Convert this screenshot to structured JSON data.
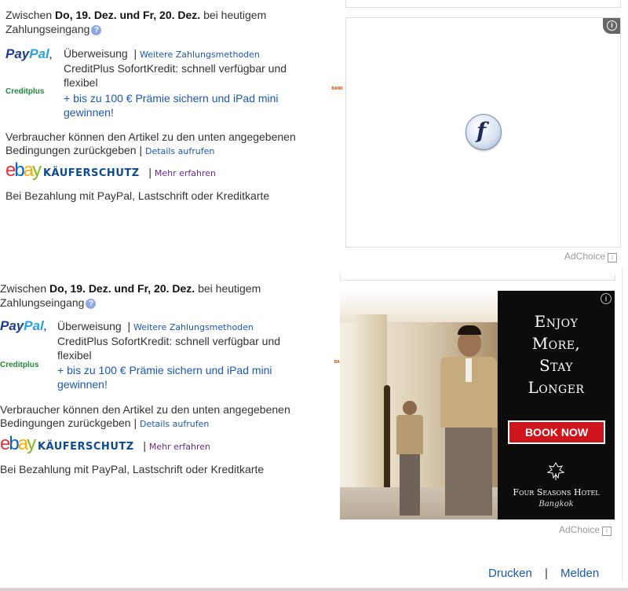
{
  "listing1": {
    "delivery_prefix": "Zwischen ",
    "delivery_dates": "Do, 19. Dez. und Fr, 20. Dez.",
    "delivery_suffix": " bei heutigem",
    "delivery_line2": "Zahlungseingang",
    "paypal_logo_a": "Pay",
    "paypal_logo_b": "Pal",
    "payment_transfer": "Überweisung",
    "more_payment_link": "Weitere Zahlungsmethoden",
    "creditplus_logo": "Creditplus",
    "creditplus_badge": "BANK",
    "creditplus_line1": "CreditPlus SofortKredit: schnell verfügbar und",
    "creditplus_line2": "flexibel",
    "promo_line1": "+ bis zu 100 € Prämie sichern und iPad mini",
    "promo_line2": "gewinnen!",
    "returns_line1": "Verbraucher können den Artikel zu den unten angegebenen",
    "returns_line2": "Bedingungen zurückgeben |",
    "details_link": "Details aufrufen",
    "ebay_logo": [
      "e",
      "b",
      "a",
      "y"
    ],
    "kauferschutz": "KÄUFERSCHUTZ",
    "learn_more_link": "Mehr erfahren",
    "protection_text": "Bei Bezahlung mit PayPal, Lastschrift oder Kreditkarte"
  },
  "listing2": {
    "delivery_prefix": "Zwischen ",
    "delivery_dates": "Do, 19. Dez. und Fr, 20. Dez.",
    "delivery_suffix": " bei heutigem",
    "delivery_line2": "Zahlungseingang",
    "paypal_logo_a": "Pay",
    "paypal_logo_b": "Pal",
    "payment_transfer": "Überweisung",
    "more_payment_link": "Weitere Zahlungsmethoden",
    "creditplus_logo": "Creditplus",
    "creditplus_badge": "BANK",
    "creditplus_line1": "CreditPlus SofortKredit: schnell verfügbar und",
    "creditplus_line2": "flexibel",
    "promo_line1": "+ bis zu 100 € Prämie sichern und iPad mini",
    "promo_line2": "gewinnen!",
    "returns_line1": "Verbraucher können den Artikel zu den unten angegebenen",
    "returns_line2": "Bedingungen zurückgeben |",
    "details_link": "Details aufrufen",
    "ebay_logo": [
      "e",
      "b",
      "a",
      "y"
    ],
    "kauferschutz": "KÄUFERSCHUTZ",
    "learn_more_link": "Mehr erfahren",
    "protection_text": "Bei Bezahlung mit PayPal, Lastschrift oder Kreditkarte"
  },
  "ad1": {
    "info_icon": "i",
    "adchoice": "AdChoice",
    "plugin_glyph": "f",
    "icon": "flash-plugin-icon"
  },
  "ad2": {
    "headline": [
      "Enjoy",
      "More,",
      "Stay",
      "Longer"
    ],
    "cta": "BOOK NOW",
    "brand": "Four Seasons Hotel",
    "brand_sub": "Bangkok",
    "info_icon": "i",
    "adchoice": "AdChoice",
    "colors": {
      "panel": "#0c0c0c",
      "cta_bg": "#d0141b"
    }
  },
  "footer": {
    "print_link": "Drucken",
    "separator": "|",
    "report_link": "Melden"
  },
  "colors": {
    "link": "#1a58b5",
    "purple_link": "#6a2a8e"
  }
}
